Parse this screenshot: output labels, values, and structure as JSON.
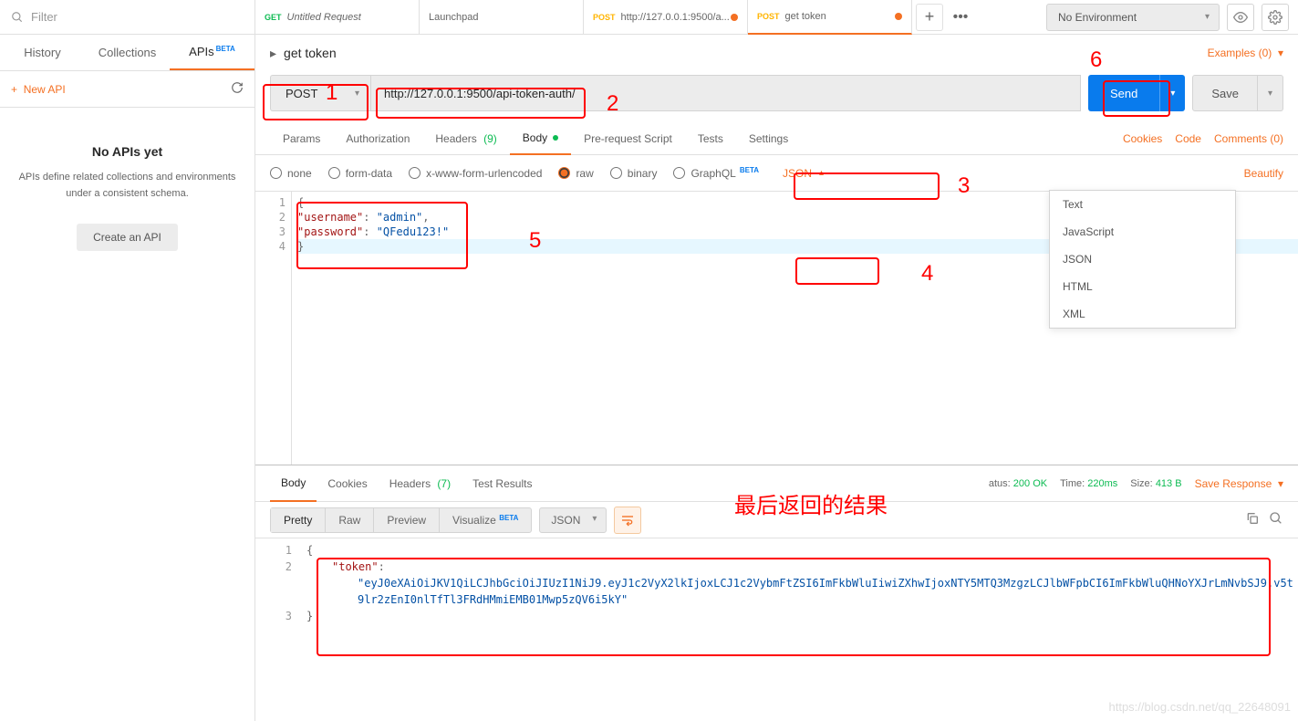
{
  "sidebar": {
    "filter_placeholder": "Filter",
    "tabs": {
      "history": "History",
      "collections": "Collections",
      "apis": "APIs",
      "beta": "BETA"
    },
    "new_api": "New API",
    "empty": {
      "title": "No APIs yet",
      "desc": "APIs define related collections and environments under a consistent schema.",
      "button": "Create an API"
    }
  },
  "topTabs": [
    {
      "method": "GET",
      "title": "Untitled Request",
      "italic": true
    },
    {
      "method": "",
      "title": "Launchpad"
    },
    {
      "method": "POST",
      "title": "http://127.0.0.1:9500/a...",
      "dirty": true
    },
    {
      "method": "POST",
      "title": "get token",
      "dirty": true,
      "active": true
    }
  ],
  "env": {
    "selected": "No Environment"
  },
  "breadcrumb": {
    "name": "get token",
    "examples": "Examples (0)"
  },
  "request": {
    "method": "POST",
    "url": "http://127.0.0.1:9500/api-token-auth/",
    "send": "Send",
    "save": "Save"
  },
  "subTabs": {
    "params": "Params",
    "auth": "Authorization",
    "headers": "Headers",
    "headers_count": "(9)",
    "body": "Body",
    "prereq": "Pre-request Script",
    "tests": "Tests",
    "settings": "Settings",
    "cookies": "Cookies",
    "code": "Code",
    "comments": "Comments (0)"
  },
  "bodyOpts": {
    "none": "none",
    "formdata": "form-data",
    "xwww": "x-www-form-urlencoded",
    "raw": "raw",
    "binary": "binary",
    "graphql": "GraphQL",
    "beta": "BETA",
    "fmt": "JSON",
    "beautify": "Beautify",
    "dropdown": [
      "Text",
      "JavaScript",
      "JSON",
      "HTML",
      "XML"
    ]
  },
  "reqBody": {
    "lines": [
      "1",
      "2",
      "3",
      "4"
    ],
    "l1": "{",
    "l2_k": "\"username\"",
    "l2_c": ": ",
    "l2_v": "\"admin\"",
    "l2_t": ",",
    "l3_k": "\"password\"",
    "l3_c": ": ",
    "l3_v": "\"QFedu123!\"",
    "l4": "}"
  },
  "respTabs": {
    "body": "Body",
    "cookies": "Cookies",
    "headers": "Headers",
    "headers_count": "(7)",
    "tests": "Test Results",
    "status_lbl": "atus:",
    "status": "200 OK",
    "time_lbl": "Time:",
    "time": "220ms",
    "size_lbl": "Size:",
    "size": "413 B",
    "save": "Save Response"
  },
  "respTools": {
    "pretty": "Pretty",
    "raw": "Raw",
    "preview": "Preview",
    "visualize": "Visualize",
    "beta": "BETA",
    "fmt": "JSON"
  },
  "respBody": {
    "l1": "{",
    "l2_k": "\"token\"",
    "l2_c": ":",
    "l2_v": "\"eyJ0eXAiOiJKV1QiLCJhbGciOiJIUzI1NiJ9.eyJ1c2VyX2lkIjoxLCJ1c2VybmFtZSI6ImFkbWluIiwiZXhwIjoxNTY5MTQ3MzgzLCJlbWFpbCI6ImFkbWluQHNoYXJrLmNvbSJ9.v5t9lr2zEnI0nlTfTl3FRdHMmiEMB01Mwp5zQV6i5kY\"",
    "l3": "}"
  },
  "annotations": {
    "a1": "1",
    "a2": "2",
    "a3": "3",
    "a4": "4",
    "a5": "5",
    "a6": "6",
    "cn": "最后返回的结果"
  },
  "watermark": "https://blog.csdn.net/qq_22648091"
}
